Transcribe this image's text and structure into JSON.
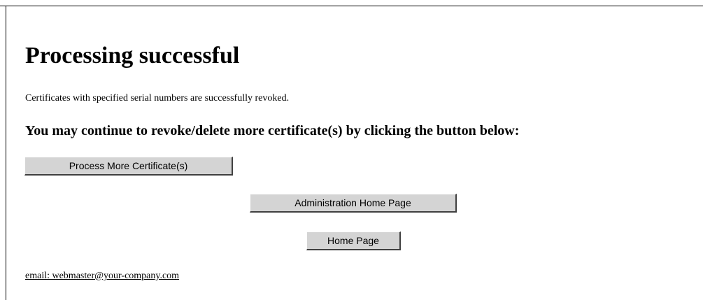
{
  "page": {
    "title": "Processing successful",
    "message": "Certificates with specified serial numbers are successfully revoked.",
    "instruction": "You may continue to revoke/delete more certificate(s) by clicking the button below:"
  },
  "buttons": {
    "process_more": "Process More Certificate(s)",
    "admin_home": "Administration Home Page",
    "home": "Home Page"
  },
  "footer": {
    "email_link": "email: webmaster@your-company.com"
  },
  "colors": {
    "background": "#ffffff",
    "text": "#000000",
    "button_face": "#d4d4d4"
  }
}
